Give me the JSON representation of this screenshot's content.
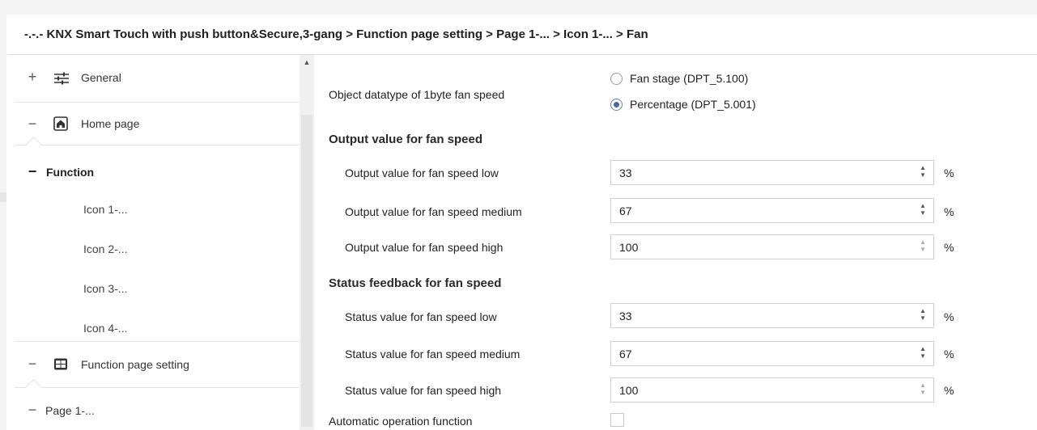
{
  "breadcrumb": "-.-.- KNX Smart Touch with push button&Secure,3-gang > Function page setting > Page 1-... > Icon 1-... > Fan",
  "sidebar": {
    "items": [
      {
        "sign": "+",
        "label": "General",
        "icon": "sliders-icon"
      },
      {
        "sign": "−",
        "label": "Home page",
        "icon": "home-icon"
      },
      {
        "sign": "−",
        "label": "Function"
      },
      {
        "label": "Icon 1-..."
      },
      {
        "label": "Icon 2-..."
      },
      {
        "label": "Icon 3-..."
      },
      {
        "label": "Icon 4-..."
      },
      {
        "sign": "−",
        "label": "Function page setting",
        "icon": "grid-icon"
      },
      {
        "sign": "−",
        "label": "Page 1-..."
      }
    ]
  },
  "params": {
    "datatype_label": "Object datatype of 1byte fan speed",
    "datatype_options": [
      "Fan stage (DPT_5.100)",
      "Percentage (DPT_5.001)"
    ],
    "datatype_selected": "Percentage (DPT_5.001)",
    "output_section": "Output value for fan speed",
    "output": [
      {
        "label": "Output value for fan speed low",
        "value": "33",
        "unit": "%"
      },
      {
        "label": "Output value for fan speed medium",
        "value": "67",
        "unit": "%"
      },
      {
        "label": "Output value for fan speed high",
        "value": "100",
        "unit": "%"
      }
    ],
    "status_section": "Status feedback for fan speed",
    "status": [
      {
        "label": "Status value for fan speed low",
        "value": "33",
        "unit": "%"
      },
      {
        "label": "Status value for fan speed medium",
        "value": "67",
        "unit": "%"
      },
      {
        "label": "Status value for fan speed high",
        "value": "100",
        "unit": "%"
      }
    ],
    "auto_label": "Automatic operation function",
    "auto_checked": false
  }
}
